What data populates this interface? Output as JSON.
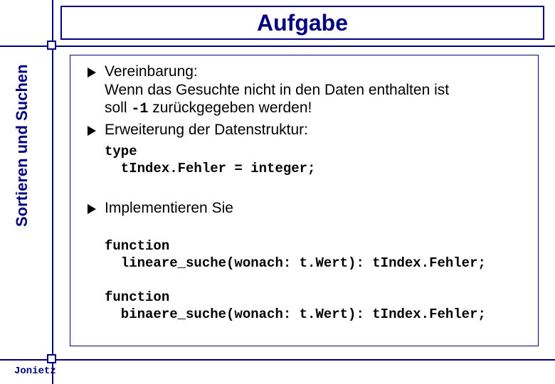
{
  "title": "Aufgabe",
  "sidebar": "Sortieren und Suchen",
  "footer": "Jonietz",
  "bullets": {
    "b1_line1": "Vereinbarung:",
    "b1_line2": "Wenn das Gesuchte nicht in den Daten enthalten ist",
    "b1_line3a": "soll ",
    "b1_code": "-1",
    "b1_line3b": " zurückgegeben werden!",
    "b2": "Erweiterung der Datenstruktur:",
    "b3": "Implementieren Sie"
  },
  "code": {
    "type_decl": "type\n  tIndex.Fehler = integer;",
    "func1": "function\n  lineare_suche(wonach: t.Wert): tIndex.Fehler;",
    "func2": "function\n  binaere_suche(wonach: t.Wert): tIndex.Fehler;"
  }
}
